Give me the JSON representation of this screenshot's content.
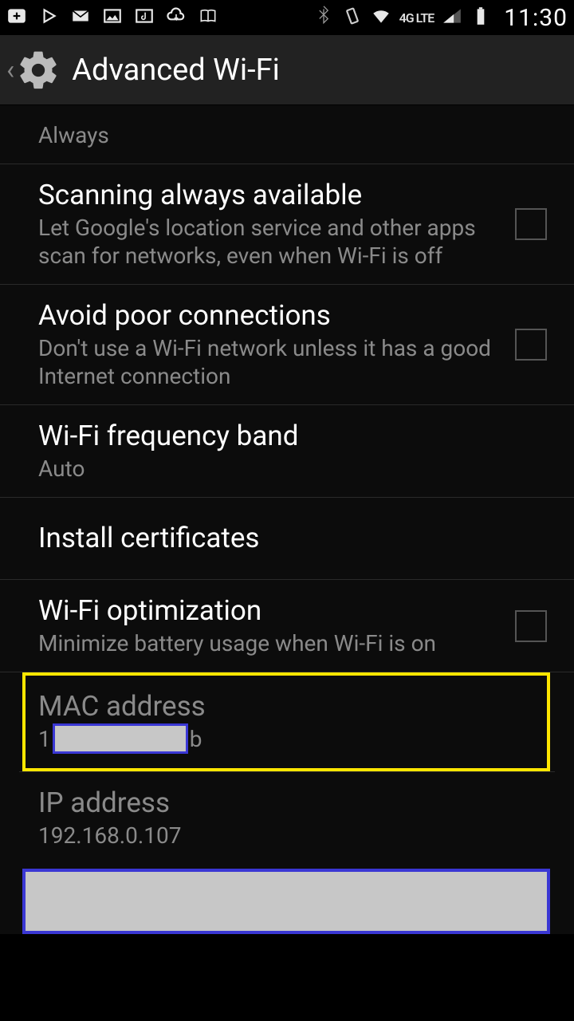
{
  "status": {
    "clock": "11:30",
    "net": "4G LTE"
  },
  "header": {
    "title": "Advanced Wi-Fi"
  },
  "items": {
    "always_sub": "Always",
    "scan_title": "Scanning always available",
    "scan_sub": "Let Google's location service and other apps scan for networks, even when Wi-Fi is off",
    "avoid_title": "Avoid poor connections",
    "avoid_sub": "Don't use a Wi-Fi network unless it has a good Internet connection",
    "freq_title": "Wi-Fi frequency band",
    "freq_sub": "Auto",
    "cert_title": "Install certificates",
    "opt_title": "Wi-Fi optimization",
    "opt_sub": "Minimize battery usage when Wi-Fi is on",
    "mac_title": "MAC address",
    "mac_prefix": "1",
    "mac_suffix": "b",
    "ip_title": "IP address",
    "ip_value": "192.168.0.107"
  }
}
